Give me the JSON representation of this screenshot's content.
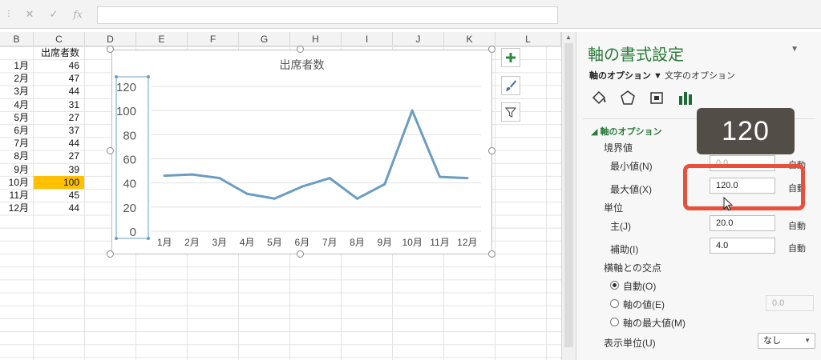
{
  "formula_bar": {
    "icons": [
      "cancel-icon",
      "enter-icon",
      "function-icon"
    ],
    "cancel_glyph": "✕",
    "enter_glyph": "✓",
    "function_glyph": "fx",
    "value": ""
  },
  "columns": [
    "B",
    "C",
    "D",
    "E",
    "F",
    "G",
    "H",
    "I",
    "J",
    "K",
    "L"
  ],
  "sheet": {
    "header": "出席者数",
    "rows": [
      {
        "month": "1月",
        "value": "46"
      },
      {
        "month": "2月",
        "value": "47"
      },
      {
        "month": "3月",
        "value": "44"
      },
      {
        "month": "4月",
        "value": "31"
      },
      {
        "month": "5月",
        "value": "27"
      },
      {
        "month": "6月",
        "value": "37"
      },
      {
        "month": "7月",
        "value": "44"
      },
      {
        "month": "8月",
        "value": "27"
      },
      {
        "month": "9月",
        "value": "39"
      },
      {
        "month": "10月",
        "value": "100"
      },
      {
        "month": "11月",
        "value": "45"
      },
      {
        "month": "12月",
        "value": "44"
      }
    ],
    "highlight_color": "#ffc000"
  },
  "chart_data": {
    "type": "line",
    "title": "出席者数",
    "categories": [
      "1月",
      "2月",
      "3月",
      "4月",
      "5月",
      "6月",
      "7月",
      "8月",
      "9月",
      "10月",
      "11月",
      "12月"
    ],
    "values": [
      46,
      47,
      44,
      31,
      27,
      37,
      44,
      27,
      39,
      100,
      45,
      44
    ],
    "y_ticks": [
      "0",
      "20",
      "40",
      "60",
      "80",
      "100",
      "120"
    ],
    "ylim": [
      0,
      120
    ],
    "grid": true,
    "line_color": "#6b9dc1"
  },
  "chart_buttons": [
    "plus-icon",
    "brush-icon",
    "filter-icon"
  ],
  "pane": {
    "title": "軸の書式設定",
    "tab_axis_options": "軸のオプション ▼",
    "tab_text_options": "文字のオプション",
    "section_title": "軸のオプション",
    "bounds_label": "境界値",
    "min_label": "最小値(N)",
    "min_value": "0.0",
    "max_label": "最大値(X)",
    "max_value": "120.0",
    "units_label": "単位",
    "major_label": "主(J)",
    "major_value": "20.0",
    "minor_label": "補助(I)",
    "minor_value": "4.0",
    "auto": "自動",
    "cross_label": "横軸との交点",
    "radio_auto": "自動(O)",
    "radio_value": "軸の値(E)",
    "radio_value_input": "0.0",
    "radio_max": "軸の最大値(M)",
    "display_unit_label": "表示単位(U)",
    "display_unit_value": "なし",
    "accent_color": "#2b7a3a"
  },
  "callout": {
    "text": "120",
    "highlight_color": "#e8503a"
  }
}
